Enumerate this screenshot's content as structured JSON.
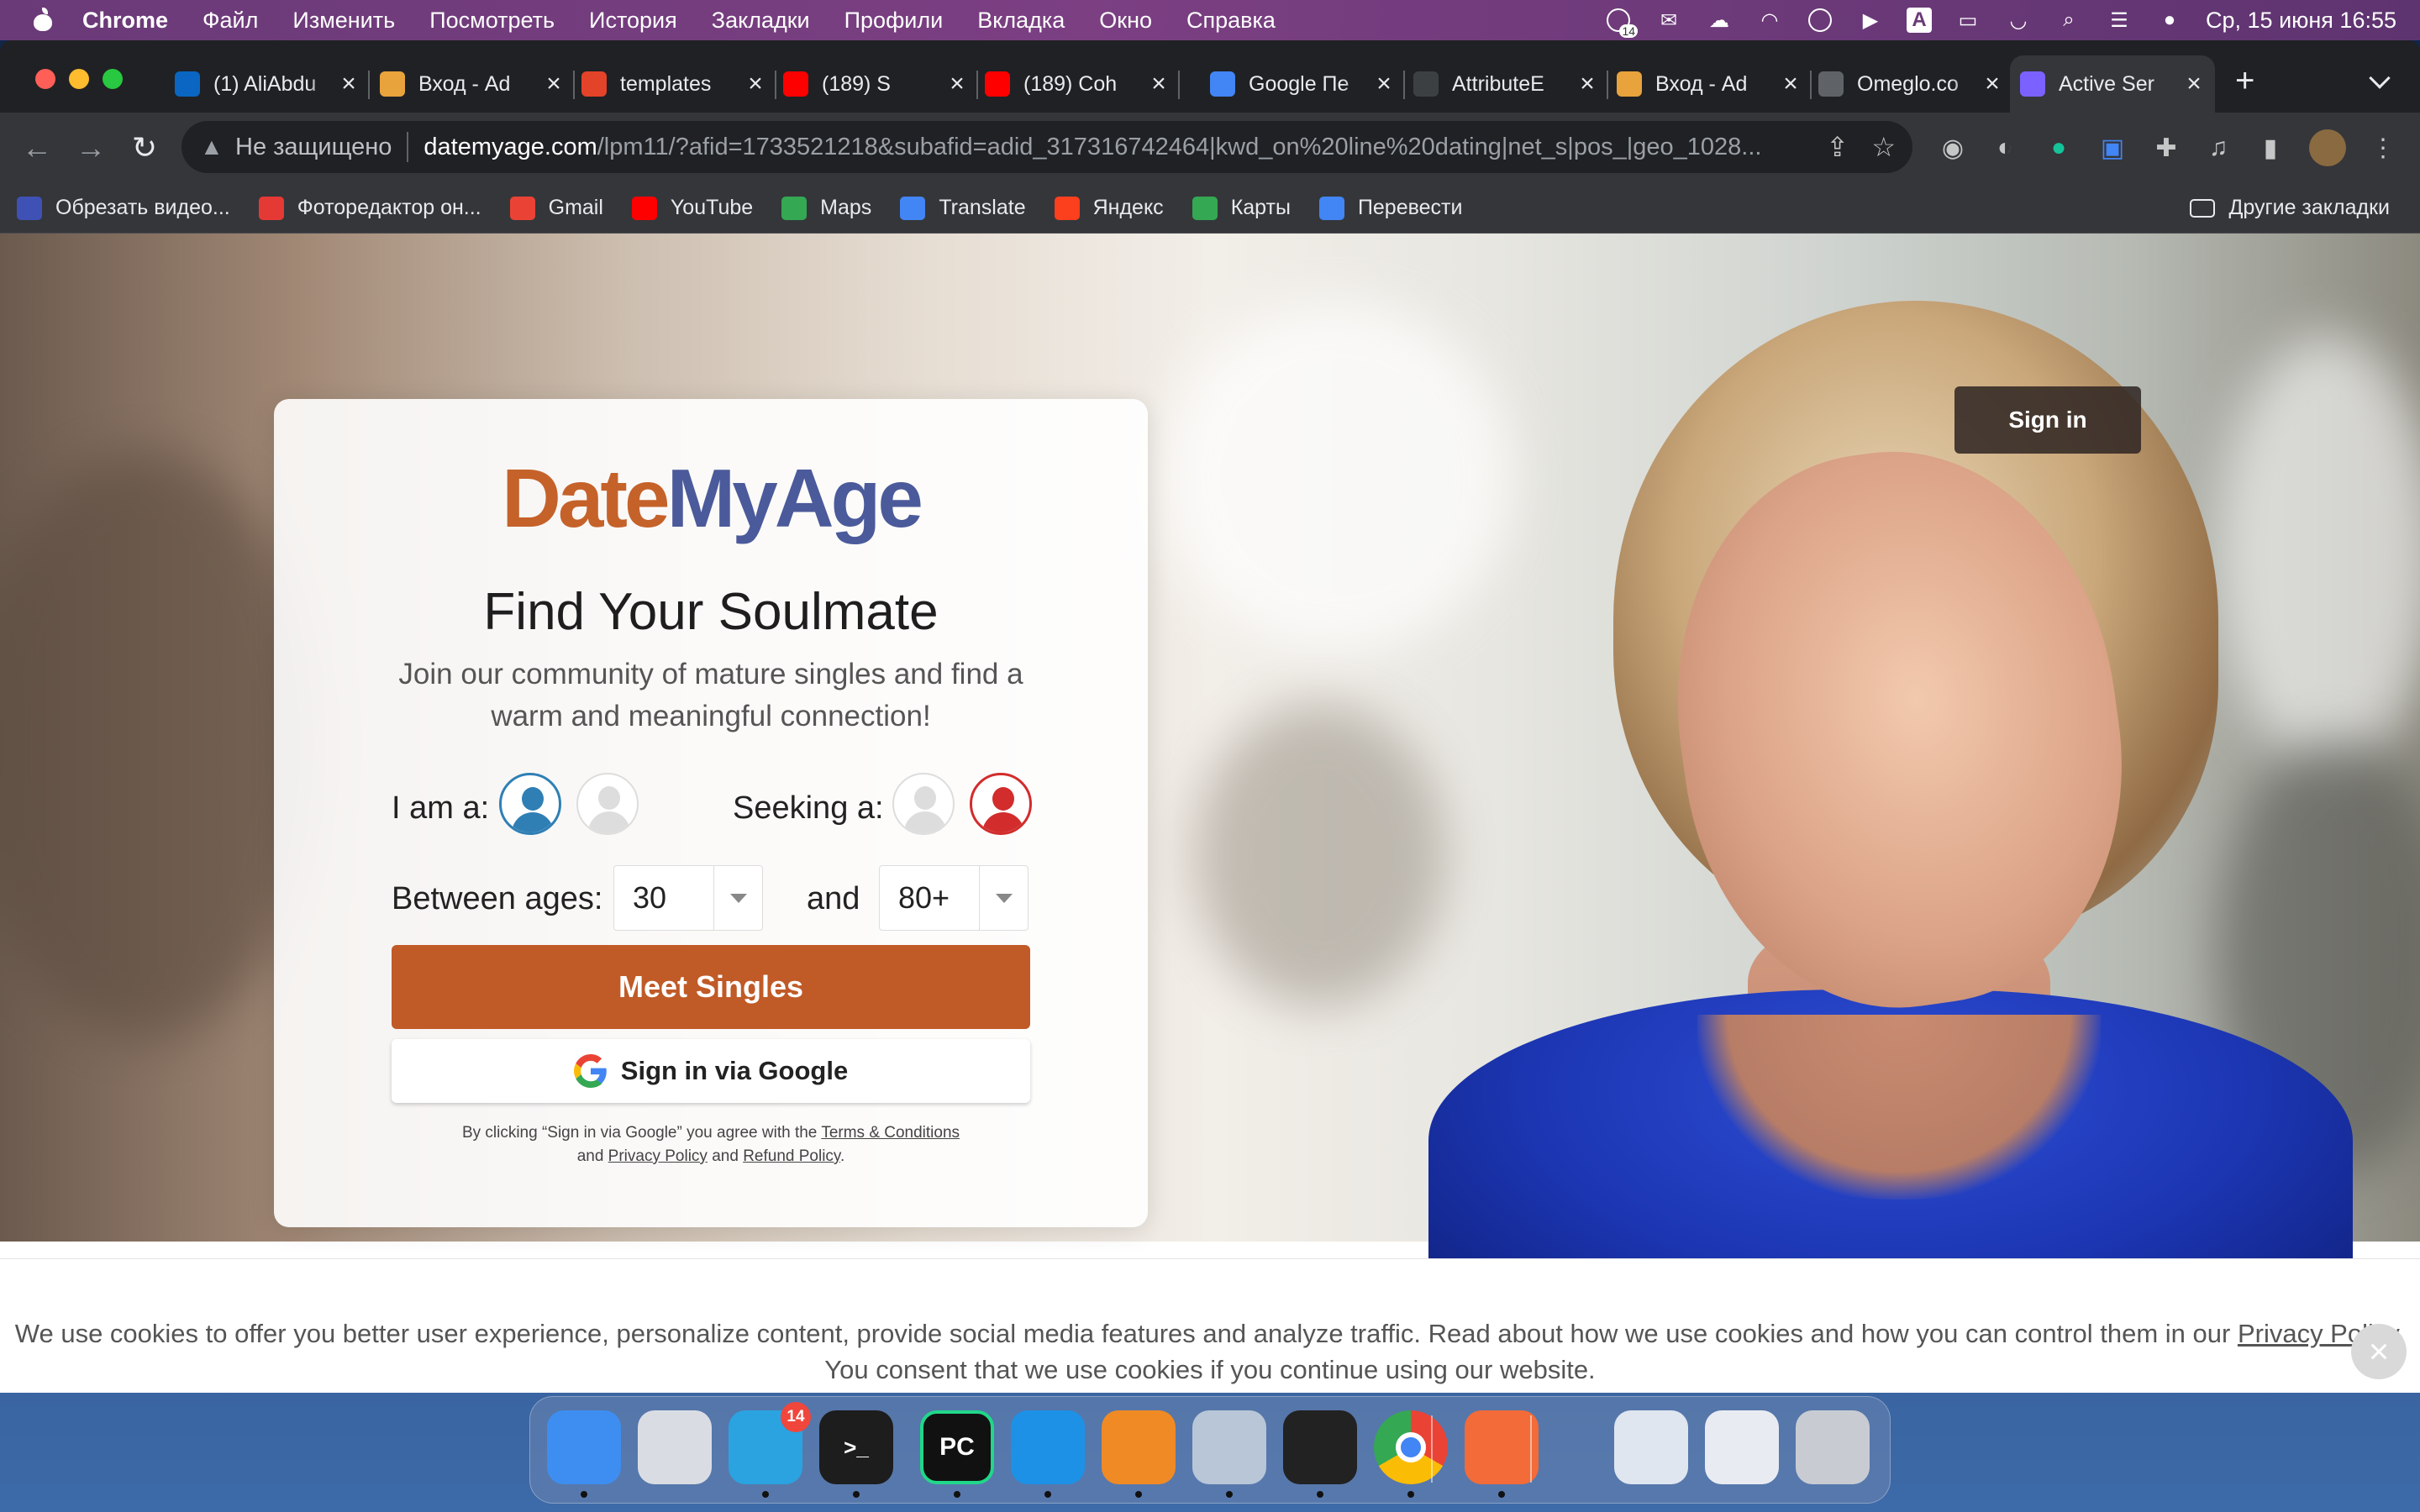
{
  "menubar": {
    "app_name": "Chrome",
    "items": [
      "Файл",
      "Изменить",
      "Посмотреть",
      "История",
      "Закладки",
      "Профили",
      "Вкладка",
      "Окно",
      "Справка"
    ],
    "status_badge": "14",
    "clock": "Ср, 15 июня  16:55"
  },
  "tabs": [
    {
      "title": "(1) AliAbdu",
      "icon": "linkedin-icon",
      "color": "#0a66c2"
    },
    {
      "title": "Вход - Ad",
      "icon": "q-icon",
      "color": "#e8a33d"
    },
    {
      "title": "templates",
      "icon": "gitlab-icon",
      "color": "#e24329"
    },
    {
      "title": "(189) S",
      "icon": "youtube-icon",
      "color": "#ff0000"
    },
    {
      "title": "(189) Coh",
      "icon": "youtube-icon",
      "color": "#ff0000"
    },
    {
      "title": "Google Пе",
      "icon": "translate-icon",
      "color": "#4285f4"
    },
    {
      "title": "AttributeE",
      "icon": "window-icon",
      "color": "#3c4043"
    },
    {
      "title": "Вход - Ad",
      "icon": "q-icon",
      "color": "#e8a33d"
    },
    {
      "title": "Omeglo.co",
      "icon": "globe-icon",
      "color": "#5f6368"
    },
    {
      "title": "Active Ser",
      "icon": "d-icon",
      "color": "#7b61ff"
    }
  ],
  "omnibox": {
    "security": "Не защищено",
    "host": "datemyage.com",
    "path": "/lpm11/?afid=1733521218&subafid=adid_317316742464|kwd_on%20line%20dating|net_s|pos_|geo_1028..."
  },
  "bookmarks": [
    {
      "label": "Обрезать видео...",
      "icon": "video-cut-icon",
      "color": "#3f51b5"
    },
    {
      "label": "Фоторедактор он...",
      "icon": "photo-editor-icon",
      "color": "#e53935"
    },
    {
      "label": "Gmail",
      "icon": "gmail-icon",
      "color": "#ea4335"
    },
    {
      "label": "YouTube",
      "icon": "youtube-icon",
      "color": "#ff0000"
    },
    {
      "label": "Maps",
      "icon": "maps-icon",
      "color": "#34a853"
    },
    {
      "label": "Translate",
      "icon": "translate-icon",
      "color": "#4285f4"
    },
    {
      "label": "Яндекс",
      "icon": "yandex-icon",
      "color": "#fc3f1d"
    },
    {
      "label": "Карты",
      "icon": "maps-icon",
      "color": "#34a853"
    },
    {
      "label": "Перевести",
      "icon": "translate-icon",
      "color": "#4285f4"
    }
  ],
  "other_bookmarks": "Другие закладки",
  "page": {
    "sign_in": "Sign in",
    "logo_part1": "Date",
    "logo_part2": "MyAge",
    "headline": "Find Your Soulmate",
    "subtitle": "Join our community of mature singles and find a warm and meaningful connection!",
    "i_am_label": "I am a:",
    "seeking_label": "Seeking a:",
    "ages_label": "Between ages:",
    "and_label": "and",
    "age_from": "30",
    "age_to": "80+",
    "meet_button": "Meet Singles",
    "google_button": "Sign in via Google",
    "legal_prefix": "By clicking “Sign in via Google” you agree with the",
    "terms_link": "Terms & Conditions",
    "legal_and1": "and",
    "privacy_link": "Privacy Policy",
    "legal_and2": "and",
    "refund_link": "Refund Policy",
    "legal_suffix": ".",
    "brand_colors": {
      "orange": "#c05a27",
      "blue": "#4b5a9a"
    }
  },
  "cookie": {
    "text1": "We use cookies to offer you better user experience, personalize content, provide social media features and analyze traffic. Read about how we use cookies and how you can control them in our",
    "link": "Privacy Policy",
    "text2": ". You consent that we use cookies if you continue using our website."
  },
  "dock": {
    "apps": [
      {
        "name": "finder-icon",
        "color": "#3d8ef0"
      },
      {
        "name": "launchpad-icon",
        "color": "#d9dde3"
      },
      {
        "name": "telegram-icon",
        "color": "#2aa3e0",
        "badge": "14"
      },
      {
        "name": "terminal-icon",
        "color": "#1d1d1d"
      },
      {
        "name": "pycharm-icon",
        "color": "#111111"
      },
      {
        "name": "docker-icon",
        "color": "#1d91e6"
      },
      {
        "name": "vpn-icon",
        "color": "#f08a24"
      },
      {
        "name": "postgres-icon",
        "color": "#b8c6d8"
      },
      {
        "name": "activity-monitor-icon",
        "color": "#222222"
      },
      {
        "name": "chrome-icon",
        "color": "#e8e8e8"
      },
      {
        "name": "sketch-icon",
        "color": "#f26b38"
      },
      {
        "name": "screenshot-window-icon",
        "color": "#dfe6f0"
      },
      {
        "name": "document-window-icon",
        "color": "#e8ecf2"
      },
      {
        "name": "trash-icon",
        "color": "#c8ccd2"
      }
    ],
    "pycharm_label": "PC",
    "terminal_label": ">_"
  }
}
